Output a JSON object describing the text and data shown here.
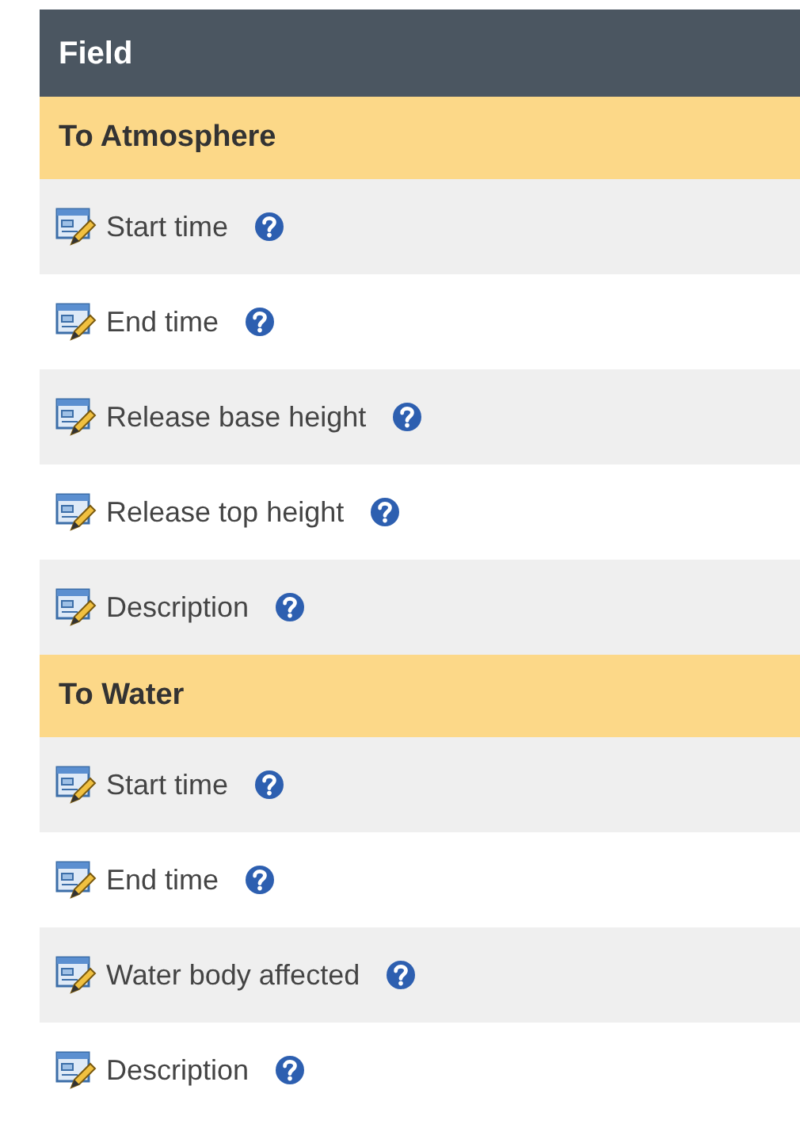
{
  "table": {
    "columns": [
      "Field"
    ],
    "sections": [
      {
        "title": "To Atmosphere",
        "rows": [
          {
            "label": "Start time"
          },
          {
            "label": "End time"
          },
          {
            "label": "Release base height"
          },
          {
            "label": "Release top height"
          },
          {
            "label": "Description"
          }
        ]
      },
      {
        "title": "To Water",
        "rows": [
          {
            "label": "Start time"
          },
          {
            "label": "End time"
          },
          {
            "label": "Water body affected"
          },
          {
            "label": "Description"
          }
        ]
      }
    ]
  }
}
